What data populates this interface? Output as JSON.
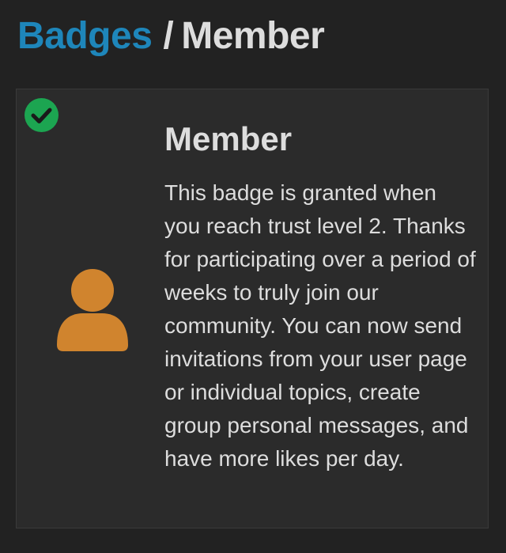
{
  "breadcrumb": {
    "parent_label": "Badges",
    "separator": "/",
    "current_label": "Member"
  },
  "badge": {
    "granted": true,
    "icon": "user-icon",
    "icon_color": "#d0842e",
    "check_color": "#1ca551",
    "title": "Member",
    "description": "This badge is granted when you reach trust level 2. Thanks for participating over a period of weeks to truly join our community. You can now send invitations from your user page or individual topics, create group personal messages, and have more likes per day."
  },
  "colors": {
    "background": "#222222",
    "card_background": "#2b2b2b",
    "link": "#1e86ba",
    "text": "#dddddd"
  }
}
